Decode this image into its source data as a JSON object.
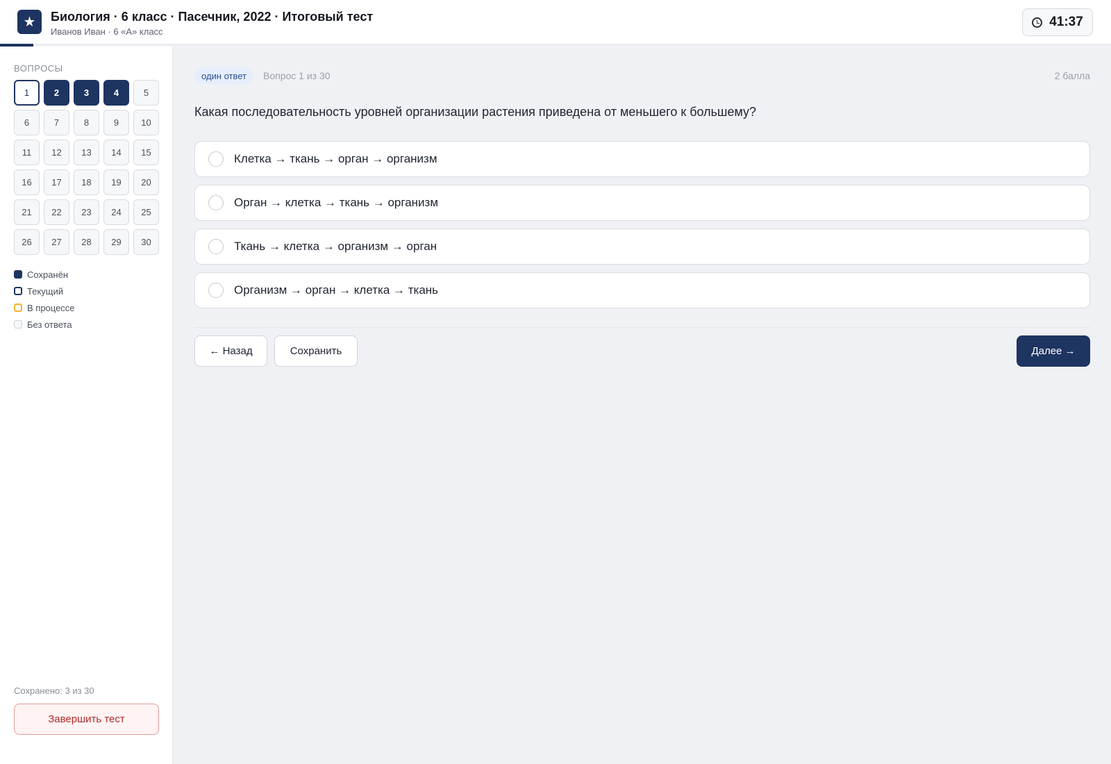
{
  "header": {
    "logo_glyph": "★",
    "title": "Биология · 6 класс · Пасечник, 2022 · Итоговый тест",
    "subtitle": "Иванов Иван · 6 «А» класс",
    "timer": "41:37"
  },
  "sidebar": {
    "heading": "ВОПРОСЫ",
    "questions": [
      {
        "n": "1",
        "state": "current"
      },
      {
        "n": "2",
        "state": "saved"
      },
      {
        "n": "3",
        "state": "saved"
      },
      {
        "n": "4",
        "state": "saved"
      },
      {
        "n": "5",
        "state": "empty"
      },
      {
        "n": "6",
        "state": "empty"
      },
      {
        "n": "7",
        "state": "empty"
      },
      {
        "n": "8",
        "state": "empty"
      },
      {
        "n": "9",
        "state": "empty"
      },
      {
        "n": "10",
        "state": "empty"
      },
      {
        "n": "11",
        "state": "empty"
      },
      {
        "n": "12",
        "state": "empty"
      },
      {
        "n": "13",
        "state": "empty"
      },
      {
        "n": "14",
        "state": "empty"
      },
      {
        "n": "15",
        "state": "empty"
      },
      {
        "n": "16",
        "state": "empty"
      },
      {
        "n": "17",
        "state": "empty"
      },
      {
        "n": "18",
        "state": "empty"
      },
      {
        "n": "19",
        "state": "empty"
      },
      {
        "n": "20",
        "state": "empty"
      },
      {
        "n": "21",
        "state": "empty"
      },
      {
        "n": "22",
        "state": "empty"
      },
      {
        "n": "23",
        "state": "empty"
      },
      {
        "n": "24",
        "state": "empty"
      },
      {
        "n": "25",
        "state": "empty"
      },
      {
        "n": "26",
        "state": "empty"
      },
      {
        "n": "27",
        "state": "empty"
      },
      {
        "n": "28",
        "state": "empty"
      },
      {
        "n": "29",
        "state": "empty"
      },
      {
        "n": "30",
        "state": "empty"
      }
    ],
    "legend": [
      {
        "label": "Сохранён",
        "swatch": "saved"
      },
      {
        "label": "Текущий",
        "swatch": "current"
      },
      {
        "label": "В процессе",
        "swatch": "progress"
      },
      {
        "label": "Без ответа",
        "swatch": "empty"
      }
    ],
    "saved_count": "Сохранено: 3 из 30",
    "finish_label": "Завершить тест"
  },
  "main": {
    "badge": "один ответ",
    "question_number": "Вопрос 1 из 30",
    "points": "2 балла",
    "question": "Какая последовательность уровней организации растения приведена от меньшего к большему?",
    "options": [
      "Клетка → ткань → орган → организм",
      "Орган → клетка → ткань → организм",
      "Ткань → клетка → организм → орган",
      "Организм → орган → клетка → ткань"
    ],
    "back_label": "← Назад",
    "save_label": "Сохранить",
    "next_label": "Далее →"
  },
  "colors": {
    "accent": "#1e3461",
    "in_progress": "#f0b429",
    "danger": "#b02a2a"
  }
}
